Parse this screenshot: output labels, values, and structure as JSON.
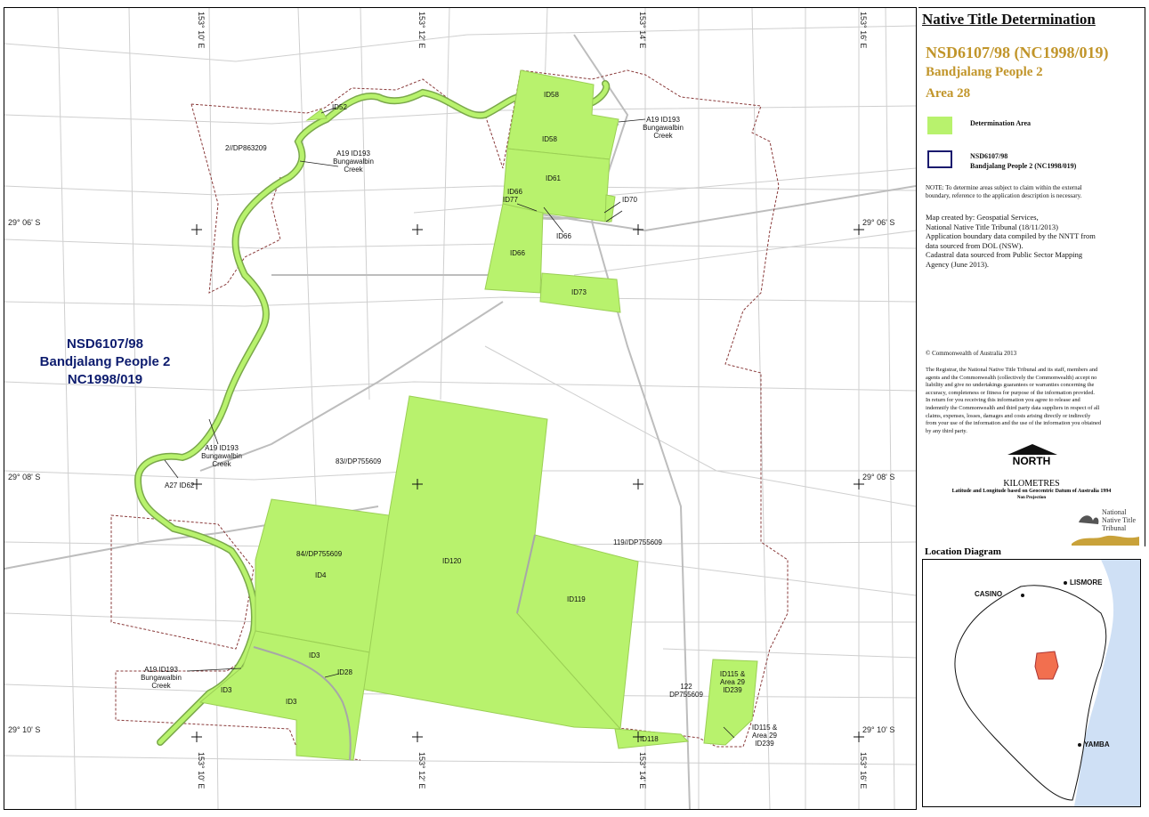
{
  "legend": {
    "title": "Native Title Determination",
    "subtitle1": "NSD6107/98 (NC1998/019)",
    "subtitle2": "Bandjalang People 2",
    "subtitle3": "Area 28",
    "determination_label": "Determination Area",
    "claim_label_line1": "NSD6107/98",
    "claim_label_line2": "Bandjalang People 2 (NC1998/019)",
    "note_line1": "NOTE: To determine areas subject to claim within the external",
    "note_line2": "boundary, reference to the application description is necessary.",
    "credits": [
      "Map created by: Geospatial Services,",
      "National Native Title Tribunal   (18/11/2013)",
      "Application boundary data compiled by the NNTT from",
      "data sourced from DOL (NSW).",
      "Cadastral data sourced from Public Sector Mapping",
      "Agency (June 2013)."
    ],
    "copyright": "© Commonwealth of Australia 2013",
    "disclaimer": [
      "The Registrar, the National Native Title Tribunal and its staff, members and",
      "agents and the Commonwealth (collectively the Commonwealth) accept no",
      "liability and give no undertakings guarantees or warranties concerning the",
      "accuracy, completeness or fitness for purpose of the information provided.",
      "In return for you receiving this information you agree to release and",
      "indemnify the Commonwealth and third party data suppliers in respect of all",
      "claims, expenses, losses, damages and costs arising directly or indirectly",
      "from your use of the information and the use of the information you obtained",
      "by any third party."
    ],
    "north": "NORTH",
    "km": "KILOMETRES",
    "datum": "Latitude and Longitude based on Geocentric Datum of Australia 1994",
    "projection": "Non Projection",
    "logo_line1": "National",
    "logo_line2": "Native Title",
    "logo_line3": "Tribunal",
    "location_title": "Location Diagram",
    "town_casino": "CASINO",
    "town_lismore": "LISMORE",
    "town_yamba": "YAMBA"
  },
  "map": {
    "claim_line1": "NSD6107/98",
    "claim_line2": "Bandjalang People 2",
    "claim_line3": "NC1998/019",
    "lon_top": [
      "153° 10' E",
      "153° 12' E",
      "153° 14' E",
      "153° 16' E"
    ],
    "lon_bottom": [
      "153° 10' E",
      "153° 12' E",
      "153° 14' E",
      "153° 16' E"
    ],
    "lat_left": [
      "29° 06' S",
      "29° 08' S",
      "29° 10' S"
    ],
    "lat_right": [
      "29° 06' S",
      "29° 08' S",
      "29° 10' S"
    ],
    "labels": {
      "id52": "ID52",
      "lot2": "2//DP863209",
      "creek_a1": "A19 ID193",
      "creek_a2": "Bungawalbin",
      "creek_a3": "Creek",
      "id58a": "ID58",
      "id58b": "ID58",
      "creek_b1": "A19 ID193",
      "creek_b2": "Bungawalbin",
      "creek_b3": "Creek",
      "id61": "ID61",
      "id66a": "ID66",
      "id77": "ID77",
      "id70": "ID70",
      "id66b": "ID66",
      "id66c": "ID66",
      "id73": "ID73",
      "creek_c1": "A19 ID193",
      "creek_c2": "Bungawalbin",
      "creek_c3": "Creek",
      "a27": "A27 ID62",
      "lot83": "83//DP755609",
      "lot84": "84//DP755609",
      "id4": "ID4",
      "id120": "ID120",
      "lot119": "119//DP755609",
      "id119": "ID119",
      "id3a": "ID3",
      "id28": "ID28",
      "creek_d1": "A19 ID193",
      "creek_d2": "Bungawalbin",
      "creek_d3": "Creek",
      "id3b": "ID3",
      "id3c": "ID3",
      "lot122a": "122",
      "lot122b": "DP755609",
      "id115a1": "ID115 &",
      "id115a2": "Area 29",
      "id115a3": "ID239",
      "id115b1": "ID115 &",
      "id115b2": "Area 29",
      "id115b3": "ID239",
      "id118": "ID118"
    }
  },
  "colors": {
    "determination": "#b8f26d",
    "claim_boundary": "#1a1a6e",
    "title_gold": "#c1952a",
    "claim_text": "#0d1c6e",
    "sea": "#cfe0f5",
    "locator": "#f26f4f"
  }
}
